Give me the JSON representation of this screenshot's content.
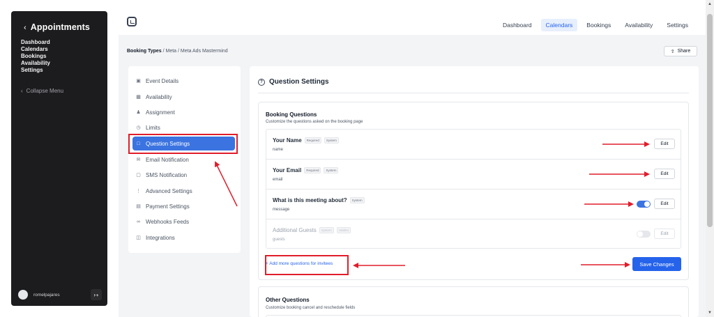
{
  "sidebar": {
    "title": "Appointments",
    "nav": [
      "Dashboard",
      "Calendars",
      "Bookings",
      "Availability",
      "Settings"
    ],
    "collapse_label": "Collapse Menu",
    "username": "romelpajares"
  },
  "topnav": {
    "items": [
      "Dashboard",
      "Calendars",
      "Bookings",
      "Availability",
      "Settings"
    ],
    "active": "Calendars"
  },
  "breadcrumb": {
    "root": "Booking Types",
    "rest": "/ Meta / Meta Ads Mastermind"
  },
  "share_label": "Share",
  "menu": {
    "items": [
      {
        "label": "Event Details",
        "icon": "file-icon"
      },
      {
        "label": "Availability",
        "icon": "calendar-icon"
      },
      {
        "label": "Assignment",
        "icon": "users-icon"
      },
      {
        "label": "Limits",
        "icon": "clock-icon"
      },
      {
        "label": "Question Settings",
        "icon": "question-icon"
      },
      {
        "label": "Email Notification",
        "icon": "mail-icon"
      },
      {
        "label": "SMS Notification",
        "icon": "message-icon"
      },
      {
        "label": "Advanced Settings",
        "icon": "sliders-icon"
      },
      {
        "label": "Payment Settings",
        "icon": "card-icon"
      },
      {
        "label": "Webhooks Feeds",
        "icon": "link-icon"
      },
      {
        "label": "Integrations",
        "icon": "puzzle-icon"
      }
    ],
    "active": "Question Settings"
  },
  "settings": {
    "title": "Question Settings",
    "booking_questions": {
      "title": "Booking Questions",
      "subtitle": "Customize the questions asked on the booking page",
      "questions": [
        {
          "label": "Your Name",
          "tags": [
            "Required",
            "System"
          ],
          "key": "name",
          "toggle": null,
          "dim": false
        },
        {
          "label": "Your Email",
          "tags": [
            "Required",
            "System"
          ],
          "key": "email",
          "toggle": null,
          "dim": false
        },
        {
          "label": "What is this meeting about?",
          "tags": [
            "System"
          ],
          "key": "message",
          "toggle": "on",
          "dim": false
        },
        {
          "label": "Additional Guests",
          "tags": [
            "System",
            "Hidden"
          ],
          "key": "guests",
          "toggle": "off",
          "dim": true
        }
      ],
      "edit_label": "Edit",
      "add_link": "+ Add more questions for invitees",
      "save_label": "Save Changes"
    },
    "other_questions": {
      "title": "Other Questions",
      "subtitle": "Customize booking cancel and reschedule fields"
    }
  },
  "colors": {
    "accent": "#2563eb",
    "active_menu": "#3b73e0",
    "annotation": "#e11d2a",
    "sidebar_bg": "#1c1c1e"
  }
}
